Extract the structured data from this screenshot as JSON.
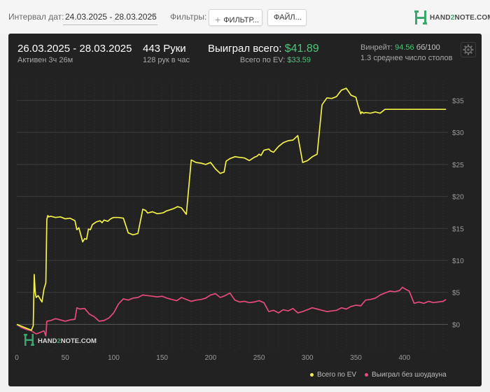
{
  "toolbar": {
    "date_label": "Интервал дат:",
    "date_value": "24.03.2025 - 28.03.2025",
    "filters_label": "Фильтры:",
    "filter_button": "ФИЛЬТР...",
    "file_button": "ФАЙЛ..."
  },
  "logo": {
    "prefix": "HAND",
    "accent": "2",
    "suffix": "NOTE.COM"
  },
  "summary": {
    "date_range": "26.03.2025 - 28.03.2025",
    "active": "Активен 3ч 26м",
    "hands": "443 Руки",
    "hands_per_hour": "128 рук в час",
    "won_label": "Выиграл всего:",
    "won_value": "$41.89",
    "ev_label": "Всего по EV:",
    "ev_value": "$33.59",
    "winrate_label": "Винрейт:",
    "winrate_value": "94.56",
    "winrate_bb": "бб/100",
    "avg_tables": "1.3 среднее число столов"
  },
  "watermark": {
    "prefix": "HAND",
    "accent": "2",
    "suffix": "NOTE.COM"
  },
  "colors": {
    "ev_line": "#f3f04a",
    "nosd_line": "#e64b7a",
    "positive": "#4cc678",
    "panel": "#222222"
  },
  "chart_data": {
    "type": "line",
    "xlabel": "",
    "ylabel": "",
    "xlim": [
      0,
      445
    ],
    "ylim": [
      -4,
      38
    ],
    "x_ticks": [
      0,
      50,
      100,
      150,
      200,
      250,
      300,
      350,
      400
    ],
    "y_ticks": [
      0,
      5,
      10,
      15,
      20,
      25,
      30,
      35
    ],
    "y_tick_labels": [
      "$0",
      "$5",
      "$10",
      "$15",
      "$20",
      "$25",
      "$30",
      "$35"
    ],
    "legend_position": "bottom-right",
    "grid": true,
    "series": [
      {
        "name": "Всего по EV",
        "color": "#f3f04a",
        "x": [
          0,
          5,
          10,
          15,
          17,
          18,
          19,
          20,
          22,
          24,
          26,
          28,
          30,
          31,
          32,
          33,
          35,
          40,
          45,
          50,
          55,
          60,
          62,
          64,
          66,
          68,
          70,
          72,
          74,
          76,
          78,
          80,
          82,
          84,
          86,
          88,
          90,
          92,
          94,
          96,
          98,
          100,
          105,
          110,
          115,
          120,
          125,
          130,
          133,
          135,
          140,
          145,
          150,
          152,
          154,
          158,
          162,
          166,
          170,
          175,
          180,
          185,
          190,
          195,
          200,
          205,
          210,
          212,
          214,
          216,
          220,
          225,
          230,
          235,
          240,
          245,
          248,
          250,
          252,
          255,
          260,
          262,
          265,
          270,
          275,
          280,
          285,
          290,
          295,
          300,
          305,
          310,
          315,
          320,
          325,
          330,
          335,
          340,
          345,
          350,
          352,
          355,
          356,
          358,
          360,
          365,
          370,
          375,
          380,
          382,
          385,
          390,
          395,
          400,
          405,
          408,
          410,
          412,
          415,
          420,
          425,
          430,
          435,
          440,
          443
        ],
        "values": [
          0,
          -0.3,
          -0.6,
          -0.9,
          -0.2,
          7.8,
          5.0,
          4.2,
          4.5,
          4.0,
          3.5,
          5.5,
          6.5,
          16.4,
          17.0,
          16.8,
          16.9,
          16.7,
          16.8,
          16.5,
          16.6,
          16.2,
          14.8,
          15.1,
          14.0,
          12.9,
          13.4,
          13.3,
          14.9,
          14.8,
          15.6,
          15.8,
          16.0,
          16.1,
          16.2,
          15.9,
          16.3,
          16.2,
          16.1,
          16.4,
          16.6,
          16.7,
          16.7,
          16.6,
          14.3,
          14.0,
          14.2,
          18.0,
          17.8,
          17.4,
          17.6,
          17.3,
          17.4,
          17.5,
          17.7,
          17.9,
          18.1,
          18.4,
          18.2,
          17.2,
          25.7,
          25.3,
          25.2,
          25.0,
          25.3,
          24.3,
          23.6,
          23.7,
          23.8,
          25.5,
          25.9,
          26.2,
          26.1,
          26.0,
          25.6,
          26.1,
          26.3,
          26.6,
          26.4,
          27.2,
          27.4,
          27.1,
          26.9,
          27.8,
          28.4,
          28.7,
          28.8,
          29.5,
          25.3,
          25.6,
          26.2,
          26.6,
          34.3,
          35.4,
          35.3,
          35.6,
          36.6,
          36.9,
          35.8,
          35.5,
          34.3,
          32.9,
          33.2,
          33.0,
          33.1,
          33.0,
          33.2,
          33.0,
          33.6,
          33.6,
          33.6,
          33.6,
          33.6,
          33.6,
          33.6,
          33.6,
          33.6,
          33.6,
          33.6,
          33.6,
          33.6,
          33.6,
          33.6,
          33.6,
          33.6
        ]
      },
      {
        "name": "Выиграл без шоудауна",
        "color": "#e64b7a",
        "x": [
          0,
          5,
          10,
          15,
          20,
          25,
          28,
          30,
          31,
          35,
          40,
          45,
          50,
          55,
          60,
          62,
          65,
          70,
          75,
          80,
          85,
          90,
          95,
          100,
          105,
          110,
          115,
          120,
          125,
          130,
          135,
          140,
          145,
          150,
          155,
          160,
          165,
          170,
          175,
          180,
          185,
          190,
          195,
          200,
          205,
          210,
          215,
          220,
          225,
          230,
          235,
          240,
          245,
          250,
          255,
          260,
          265,
          270,
          275,
          280,
          285,
          290,
          295,
          300,
          305,
          310,
          315,
          320,
          325,
          330,
          335,
          340,
          345,
          350,
          355,
          360,
          365,
          370,
          375,
          380,
          385,
          390,
          395,
          398,
          400,
          405,
          410,
          415,
          420,
          425,
          430,
          435,
          440,
          443
        ],
        "values": [
          0.0,
          -0.5,
          -0.8,
          -1.0,
          -1.5,
          -1.2,
          -1.0,
          -1.8,
          0.5,
          0.6,
          0.9,
          0.7,
          0.5,
          0.7,
          0.8,
          2.6,
          2.4,
          2.5,
          1.6,
          1.2,
          0.5,
          0.6,
          1.0,
          1.8,
          3.2,
          4.0,
          3.8,
          4.1,
          4.2,
          4.6,
          4.5,
          4.4,
          4.3,
          4.4,
          4.1,
          3.9,
          3.7,
          4.2,
          3.9,
          3.6,
          3.8,
          3.9,
          4.1,
          4.6,
          4.8,
          4.2,
          4.5,
          4.9,
          3.8,
          3.5,
          3.6,
          3.4,
          3.5,
          3.7,
          3.4,
          2.0,
          2.2,
          1.8,
          2.3,
          2.1,
          2.5,
          1.8,
          2.0,
          2.3,
          2.6,
          2.4,
          2.2,
          2.0,
          2.1,
          2.2,
          2.6,
          2.4,
          2.8,
          3.0,
          2.9,
          3.8,
          3.9,
          4.1,
          4.6,
          4.9,
          5.2,
          5.1,
          5.3,
          5.8,
          5.6,
          5.2,
          3.3,
          3.5,
          3.3,
          3.6,
          3.4,
          3.5,
          3.6,
          3.9
        ]
      }
    ]
  }
}
